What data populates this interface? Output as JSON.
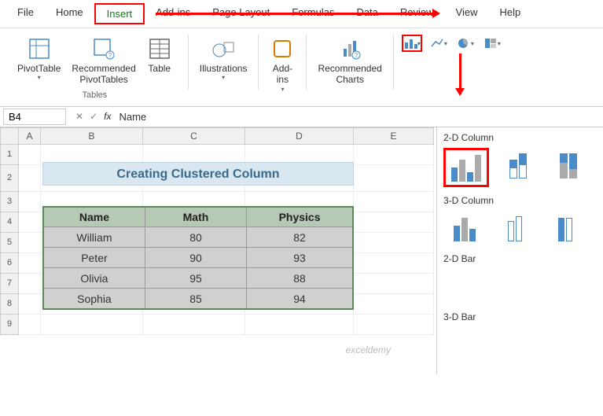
{
  "menu": {
    "file": "File",
    "home": "Home",
    "insert": "Insert",
    "addins": "Add-ins",
    "pagelayout": "Page Layout",
    "formulas": "Formulas",
    "data": "Data",
    "review": "Review",
    "view": "View",
    "help": "Help"
  },
  "ribbon": {
    "pivottable": "PivotTable",
    "recpivot": "Recommended\nPivotTables",
    "table": "Table",
    "tables_group": "Tables",
    "illustrations": "Illustrations",
    "addins": "Add-\nins",
    "reccharts": "Recommended\nCharts"
  },
  "namebox": {
    "cellref": "B4",
    "formula_value": "Name"
  },
  "columns": {
    "A": "A",
    "B": "B",
    "C": "C",
    "D": "D",
    "E": "E"
  },
  "rows": {
    "r1": "1",
    "r2": "2",
    "r3": "3",
    "r4": "4",
    "r5": "5",
    "r6": "6",
    "r7": "7",
    "r8": "8",
    "r9": "9"
  },
  "title": "Creating Clustered Column",
  "headers": {
    "name": "Name",
    "math": "Math",
    "physics": "Physics"
  },
  "data": [
    {
      "name": "William",
      "math": "80",
      "physics": "82"
    },
    {
      "name": "Peter",
      "math": "90",
      "physics": "93"
    },
    {
      "name": "Olivia",
      "math": "95",
      "physics": "88"
    },
    {
      "name": "Sophia",
      "math": "85",
      "physics": "94"
    }
  ],
  "chart_sections": {
    "col2d": "2-D Column",
    "col3d": "3-D Column",
    "bar2d": "2-D Bar",
    "bar3d": "3-D Bar"
  },
  "watermark": "exceldemy",
  "chart_data": {
    "type": "table",
    "title": "Creating Clustered Column",
    "categories": [
      "William",
      "Peter",
      "Olivia",
      "Sophia"
    ],
    "series": [
      {
        "name": "Math",
        "values": [
          80,
          90,
          95,
          85
        ]
      },
      {
        "name": "Physics",
        "values": [
          82,
          93,
          88,
          94
        ]
      }
    ]
  }
}
